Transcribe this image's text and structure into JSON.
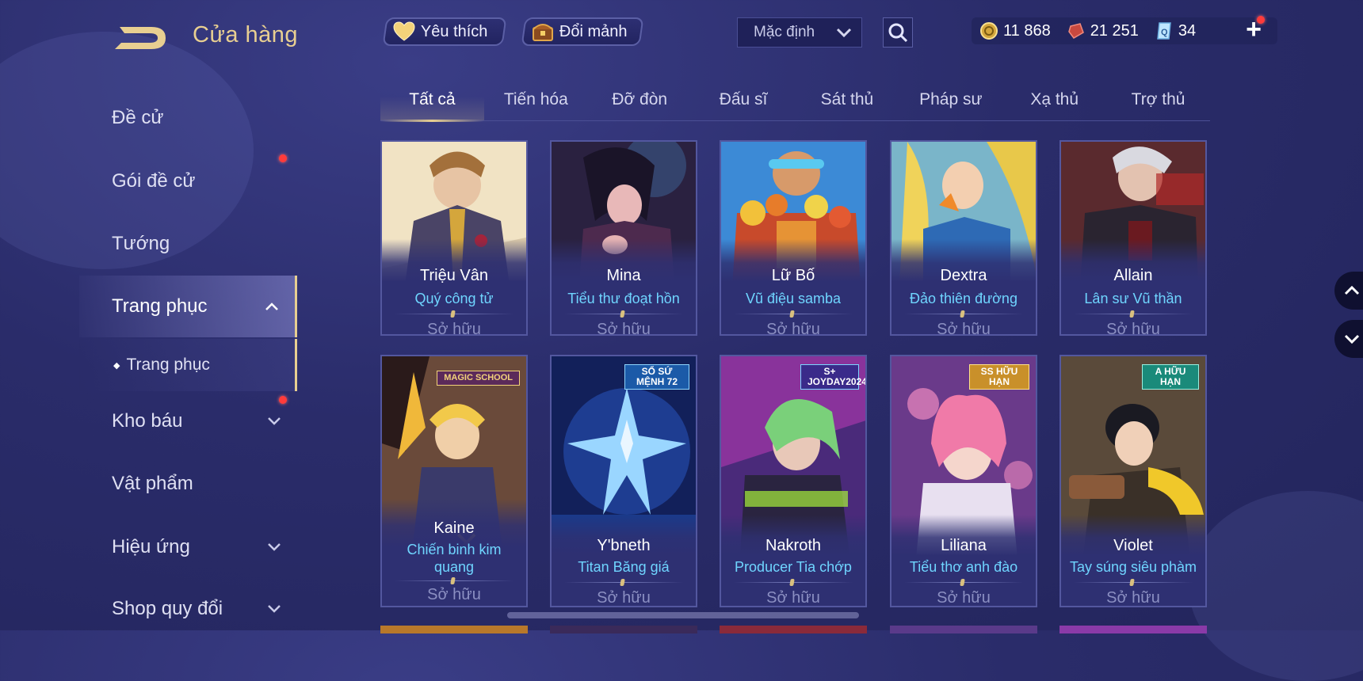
{
  "header": {
    "title": "Cửa hàng",
    "favorite_label": "Yêu thích",
    "exchange_label": "Đổi mảnh",
    "sort_selected": "Mặc định",
    "currencies": [
      {
        "icon": "gold-coin-icon",
        "value": "11 868"
      },
      {
        "icon": "ruby-gem-icon",
        "value": "21 251"
      },
      {
        "icon": "ticket-icon",
        "value": "34"
      }
    ],
    "plus_label": "+"
  },
  "sidebar": {
    "items": [
      {
        "label": "Đề cử"
      },
      {
        "label": "Gói đề cử"
      },
      {
        "label": "Tướng"
      },
      {
        "label": "Trang phục"
      },
      {
        "label": "Trang phục"
      },
      {
        "label": "Kho báu"
      },
      {
        "label": "Vật phẩm"
      },
      {
        "label": "Hiệu ứng"
      },
      {
        "label": "Shop quy đổi"
      }
    ]
  },
  "tabs": [
    "Tất cả",
    "Tiến hóa",
    "Đỡ đòn",
    "Đấu sĩ",
    "Sát thủ",
    "Pháp sư",
    "Xạ thủ",
    "Trợ thủ"
  ],
  "skins": [
    {
      "hero": "Triệu Vân",
      "skin": "Quý công tử",
      "status": "Sở hữu"
    },
    {
      "hero": "Mina",
      "skin": "Tiểu thư đoạt hồn",
      "status": "Sở hữu"
    },
    {
      "hero": "Lữ Bố",
      "skin": "Vũ điệu samba",
      "status": "Sở hữu"
    },
    {
      "hero": "Dextra",
      "skin": "Đảo thiên đường",
      "status": "Sở hữu"
    },
    {
      "hero": "Allain",
      "skin": "Lân sư Vũ thần",
      "status": "Sở hữu"
    },
    {
      "hero": "Kaine",
      "skin": "Chiến binh kim quang",
      "status": "Sở hữu",
      "badge": "MAGIC SCHOOL"
    },
    {
      "hero": "Y'bneth",
      "skin": "Titan Băng giá",
      "status": "Sở hữu",
      "badge": "SỔ SỨ MỆNH 72"
    },
    {
      "hero": "Nakroth",
      "skin": "Producer Tia chớp",
      "status": "Sở hữu",
      "badge": "S+ JOYDAY2024"
    },
    {
      "hero": "Liliana",
      "skin": "Tiểu thơ anh đào",
      "status": "Sở hữu",
      "badge": "SS HỮU HẠN"
    },
    {
      "hero": "Violet",
      "skin": "Tay súng siêu phàm",
      "status": "Sở hữu",
      "badge": "A HỮU HẠN"
    }
  ],
  "colors": {
    "accent_gold": "#e8cf91",
    "skin_name": "#6fd5ff",
    "background": "#2a2c6a"
  }
}
